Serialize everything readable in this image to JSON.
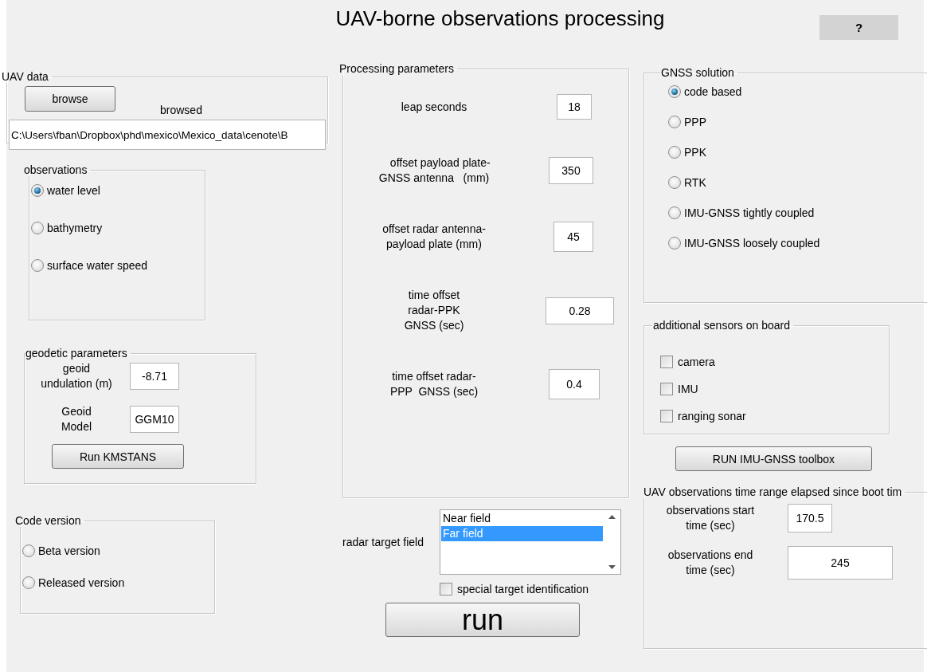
{
  "window": {
    "title": "UAV-borne observations processing",
    "help_button": "?"
  },
  "uav_data": {
    "title": "UAV data",
    "browse_button": "browse",
    "browsed_label": "browsed",
    "path": "C:\\Users\\fban\\Dropbox\\phd\\mexico\\Mexico_data\\cenote\\B"
  },
  "observations": {
    "title": "observations",
    "options": [
      {
        "label": "water level",
        "selected": true
      },
      {
        "label": "bathymetry",
        "selected": false
      },
      {
        "label": "surface water speed",
        "selected": false
      }
    ]
  },
  "geodetic_parameters": {
    "title": "geodetic parameters",
    "fields": [
      {
        "label": "geoid\nundulation (m)",
        "value": "-8.71"
      },
      {
        "label": "Geoid\nModel",
        "value": "GGM10"
      }
    ],
    "button": "Run KMSTANS"
  },
  "code_version": {
    "title": "Code version",
    "options": [
      {
        "label": "Beta version",
        "selected": false
      },
      {
        "label": "Released version",
        "selected": false
      }
    ]
  },
  "processing_parameters": {
    "title": "Processing parameters",
    "fields": [
      {
        "label": "leap seconds",
        "value": "18"
      },
      {
        "label": "    offset payload plate-\nGNSS antenna   (mm)",
        "value": "350"
      },
      {
        "label": "offset radar antenna-\npayload plate (mm)",
        "value": "45"
      },
      {
        "label": "time offset\nradar-PPK\nGNSS (sec)",
        "value": "0.28"
      },
      {
        "label": "time offset radar-\nPPP  GNSS (sec)",
        "value": "0.4"
      }
    ]
  },
  "radar_target": {
    "label": "radar target field",
    "items": [
      {
        "label": "Near field",
        "selected": false
      },
      {
        "label": "Far field",
        "selected": true
      }
    ],
    "special_target": {
      "label": "special target identification",
      "checked": false
    }
  },
  "run_button": "run",
  "gnss_solution": {
    "title": "GNSS solution",
    "options": [
      {
        "label": "code based",
        "selected": true
      },
      {
        "label": "PPP",
        "selected": false
      },
      {
        "label": "PPK",
        "selected": false
      },
      {
        "label": "RTK",
        "selected": false
      },
      {
        "label": "IMU-GNSS tightly coupled",
        "selected": false
      },
      {
        "label": "IMU-GNSS loosely coupled",
        "selected": false
      }
    ]
  },
  "sensors": {
    "title": "additional sensors on board",
    "items": [
      {
        "label": "camera",
        "checked": false
      },
      {
        "label": "IMU",
        "checked": false
      },
      {
        "label": "ranging sonar",
        "checked": false
      }
    ]
  },
  "imu_button": "RUN  IMU-GNSS  toolbox",
  "time_range": {
    "title": "UAV observations time range elapsed since boot tim",
    "fields": [
      {
        "label": "observations start\ntime (sec)",
        "value": "170.5"
      },
      {
        "label": "observations end\ntime (sec)",
        "value": "245"
      }
    ]
  }
}
